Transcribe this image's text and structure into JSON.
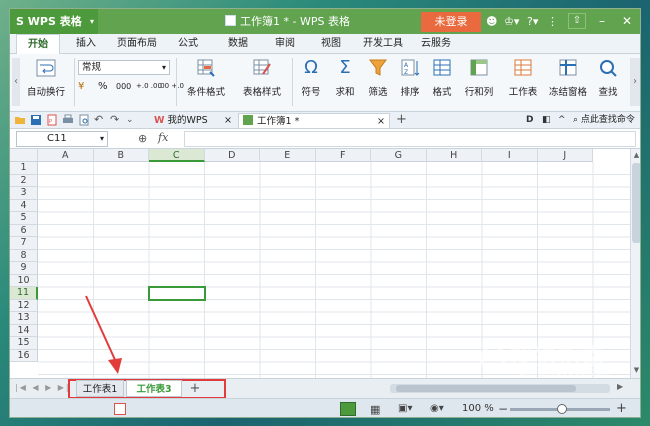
{
  "app": {
    "logo": "S WPS 表格",
    "doc_title": "工作簿1 * - WPS 表格",
    "login": "未登录"
  },
  "menu_tabs": [
    "开始",
    "插入",
    "页面布局",
    "公式",
    "数据",
    "审阅",
    "视图",
    "开发工具",
    "云服务"
  ],
  "ribbon": {
    "wrap": "自动换行",
    "format": "常规",
    "currency": "¥",
    "percent": "%",
    "thousands": "000",
    "inc_decimal": "+.0 .00",
    "dec_decimal": ".00 +.0",
    "cond_format": "条件格式",
    "table_style": "表格样式",
    "symbol": "符号",
    "sum": "求和",
    "filter": "筛选",
    "sort": "排序",
    "cell_format": "格式",
    "row_col": "行和列",
    "worksheet": "工作表",
    "freeze": "冻结窗格",
    "find": "查找"
  },
  "quickbar": {
    "my_wps": "我的WPS",
    "doc_tab": "工作簿1 *",
    "search": "点此查找命令"
  },
  "formula_bar": {
    "name_box": "C11",
    "fx": "fx"
  },
  "grid": {
    "columns": [
      "A",
      "B",
      "C",
      "D",
      "E",
      "F",
      "G",
      "H",
      "I",
      "J"
    ],
    "rows": [
      "1",
      "2",
      "3",
      "4",
      "5",
      "6",
      "7",
      "8",
      "9",
      "10",
      "11",
      "12",
      "13",
      "14",
      "15",
      "16"
    ],
    "active_col": "C",
    "active_row": "11"
  },
  "sheets": {
    "tabs": [
      "工作表1",
      "工作表3"
    ],
    "active": "工作表3",
    "add": "+"
  },
  "status": {
    "zoom": "100 %"
  },
  "watermark": "搜狗指南",
  "watermark_url": "zhinan.sogou.com",
  "colors": {
    "accent_green": "#61a34e",
    "login_orange": "#e86a3e",
    "highlight_red": "#e23b3b"
  }
}
